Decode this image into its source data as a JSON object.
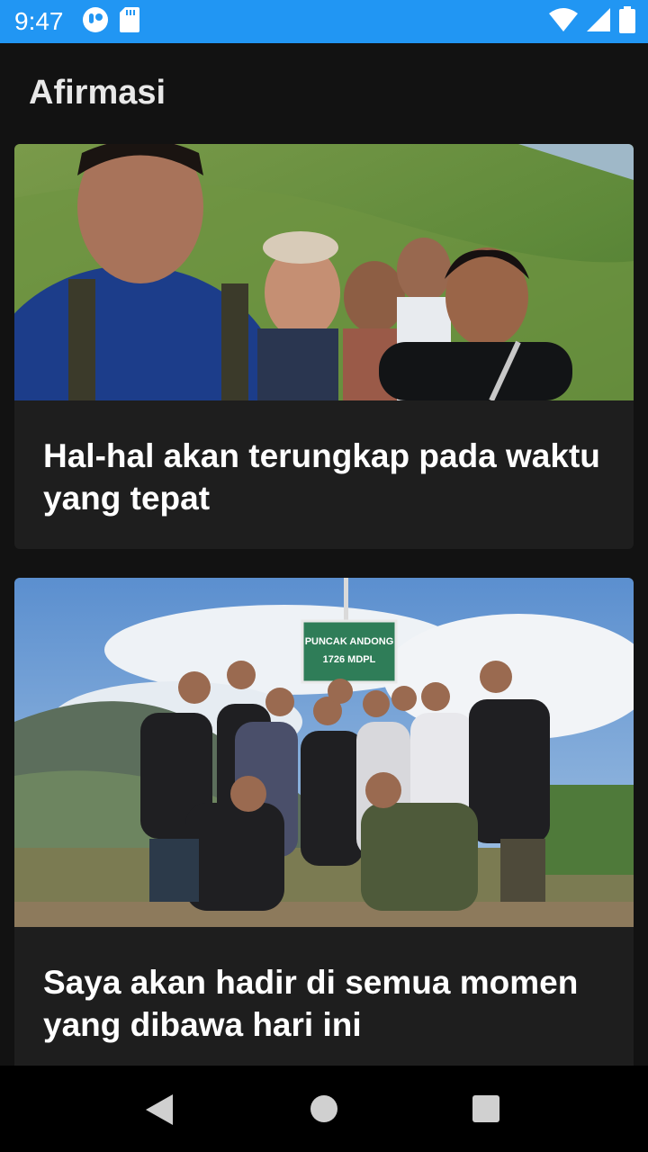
{
  "status_bar": {
    "time": "9:47",
    "left_icons": [
      "assistant-icon",
      "sd-card-icon"
    ],
    "right_icons": [
      "wifi-icon",
      "cellular-signal-icon",
      "battery-icon"
    ],
    "color": "#2196f3"
  },
  "app": {
    "title": "Afirmasi"
  },
  "cards": [
    {
      "text": "Hal-hal akan terungkap pada waktu yang tepat",
      "image": "group-selfie-photo"
    },
    {
      "text": "Saya akan hadir di semua momen yang dibawa hari ini",
      "image": "group-summit-photo"
    }
  ],
  "summit_sign": {
    "line1": "PUNCAK ANDONG",
    "line2": "1726 MDPL"
  },
  "nav_bar": {
    "icons": [
      "back-icon",
      "home-icon",
      "recents-icon"
    ]
  }
}
